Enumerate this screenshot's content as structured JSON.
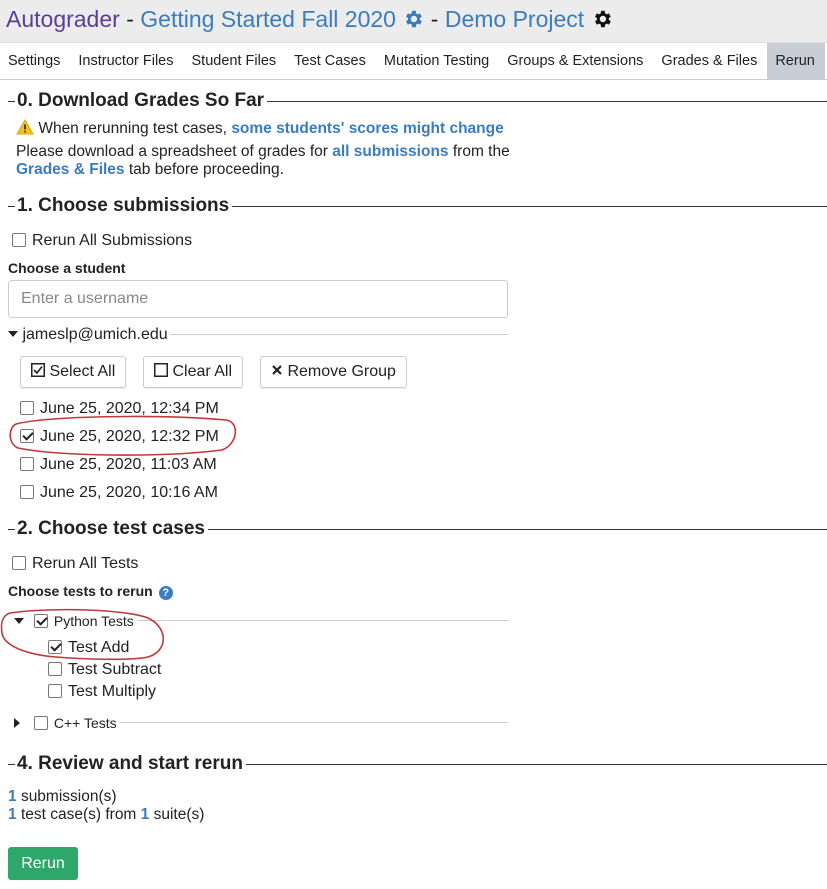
{
  "header": {
    "brand": "Autograder",
    "separator": "-",
    "course": "Getting Started Fall 2020",
    "project": "Demo Project"
  },
  "tabs": [
    {
      "label": "Settings"
    },
    {
      "label": "Instructor Files"
    },
    {
      "label": "Student Files"
    },
    {
      "label": "Test Cases"
    },
    {
      "label": "Mutation Testing"
    },
    {
      "label": "Groups & Extensions"
    },
    {
      "label": "Grades & Files"
    },
    {
      "label": "Rerun",
      "active": true
    }
  ],
  "section0": {
    "title": "0. Download Grades So Far",
    "warning_prefix": "When rerunning test cases,",
    "warning_link": "some students' scores might change",
    "line1_prefix": "Please download a spreadsheet of grades for",
    "line1_link": "all submissions",
    "line1_suffix": "from the",
    "line2_link": "Grades & Files",
    "line2_suffix": "tab before proceeding."
  },
  "section1": {
    "title": "1. Choose submissions",
    "rerun_all_label": "Rerun All Submissions",
    "choose_student_label": "Choose a student",
    "username_placeholder": "Enter a username",
    "group_name": "jameslp@umich.edu",
    "select_all": "Select All",
    "clear_all": "Clear All",
    "remove_group": "Remove Group",
    "submissions": [
      {
        "label": "June 25, 2020, 12:34 PM",
        "checked": false
      },
      {
        "label": "June 25, 2020, 12:32 PM",
        "checked": true
      },
      {
        "label": "June 25, 2020, 11:03 AM",
        "checked": false
      },
      {
        "label": "June 25, 2020, 10:16 AM",
        "checked": false
      }
    ]
  },
  "section2": {
    "title": "2. Choose test cases",
    "rerun_all_label": "Rerun All Tests",
    "choose_tests_label": "Choose tests to rerun",
    "help_glyph": "?",
    "suites": [
      {
        "name": "Python Tests",
        "checked": true,
        "expanded": true,
        "tests": [
          {
            "name": "Test Add",
            "checked": true
          },
          {
            "name": "Test Subtract",
            "checked": false
          },
          {
            "name": "Test Multiply",
            "checked": false
          }
        ]
      },
      {
        "name": "C++ Tests",
        "checked": false,
        "expanded": false,
        "tests": []
      }
    ]
  },
  "section4": {
    "title": "4. Review and start rerun",
    "submission_count": "1",
    "submission_suffix": "submission(s)",
    "test_count": "1",
    "test_middle": "test case(s) from",
    "suite_count": "1",
    "suite_suffix": "suite(s)",
    "rerun_button": "Rerun"
  },
  "colors": {
    "brand": "#5b3c99",
    "link": "#3a7cbf",
    "active_tab": "#c8cdd6",
    "rerun_button": "#2ea86a",
    "annotation": "#c0393b"
  }
}
